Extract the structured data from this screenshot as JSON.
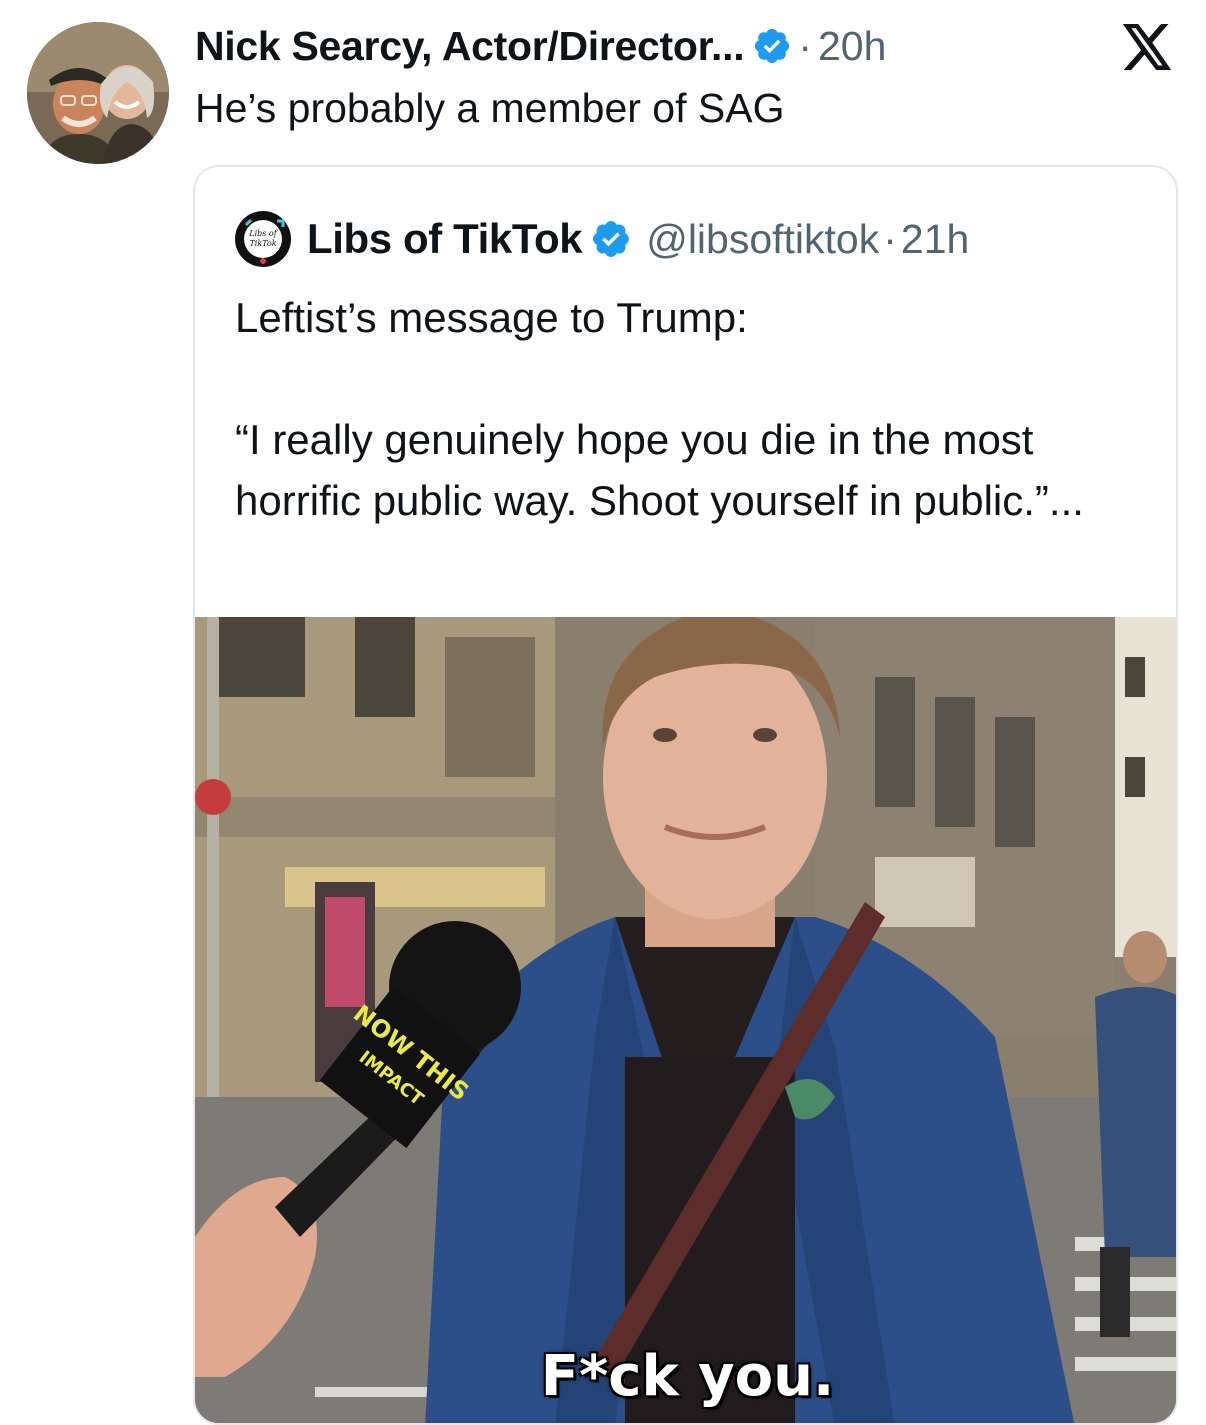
{
  "tweet": {
    "author_name": "Nick Searcy, Actor/Director...",
    "dot": "·",
    "time": "20h",
    "text": "He’s probably a member of SAG",
    "avatar_icon": "profile-photo-avatar"
  },
  "quote": {
    "author_name": "Libs of TikTok",
    "handle": "@libsoftiktok",
    "dot": "·",
    "time": "21h",
    "text": "Leftist’s message to Trump:\n\n“I really genuinely hope you die in the most horrific public way. Shoot yourself in public.”...",
    "avatar_label_1": "Libs of",
    "avatar_label_2": "TikTok",
    "media": {
      "caption": "F*ck you.",
      "mic_label_1": "NOW THIS",
      "mic_label_2": "IMPACT"
    }
  },
  "icons": {
    "verified": "verified-badge-icon",
    "close": "x-logo-icon"
  },
  "colors": {
    "verified_blue": "#1d9bf0",
    "secondary_text": "#536471",
    "border": "#e4e8eb"
  }
}
